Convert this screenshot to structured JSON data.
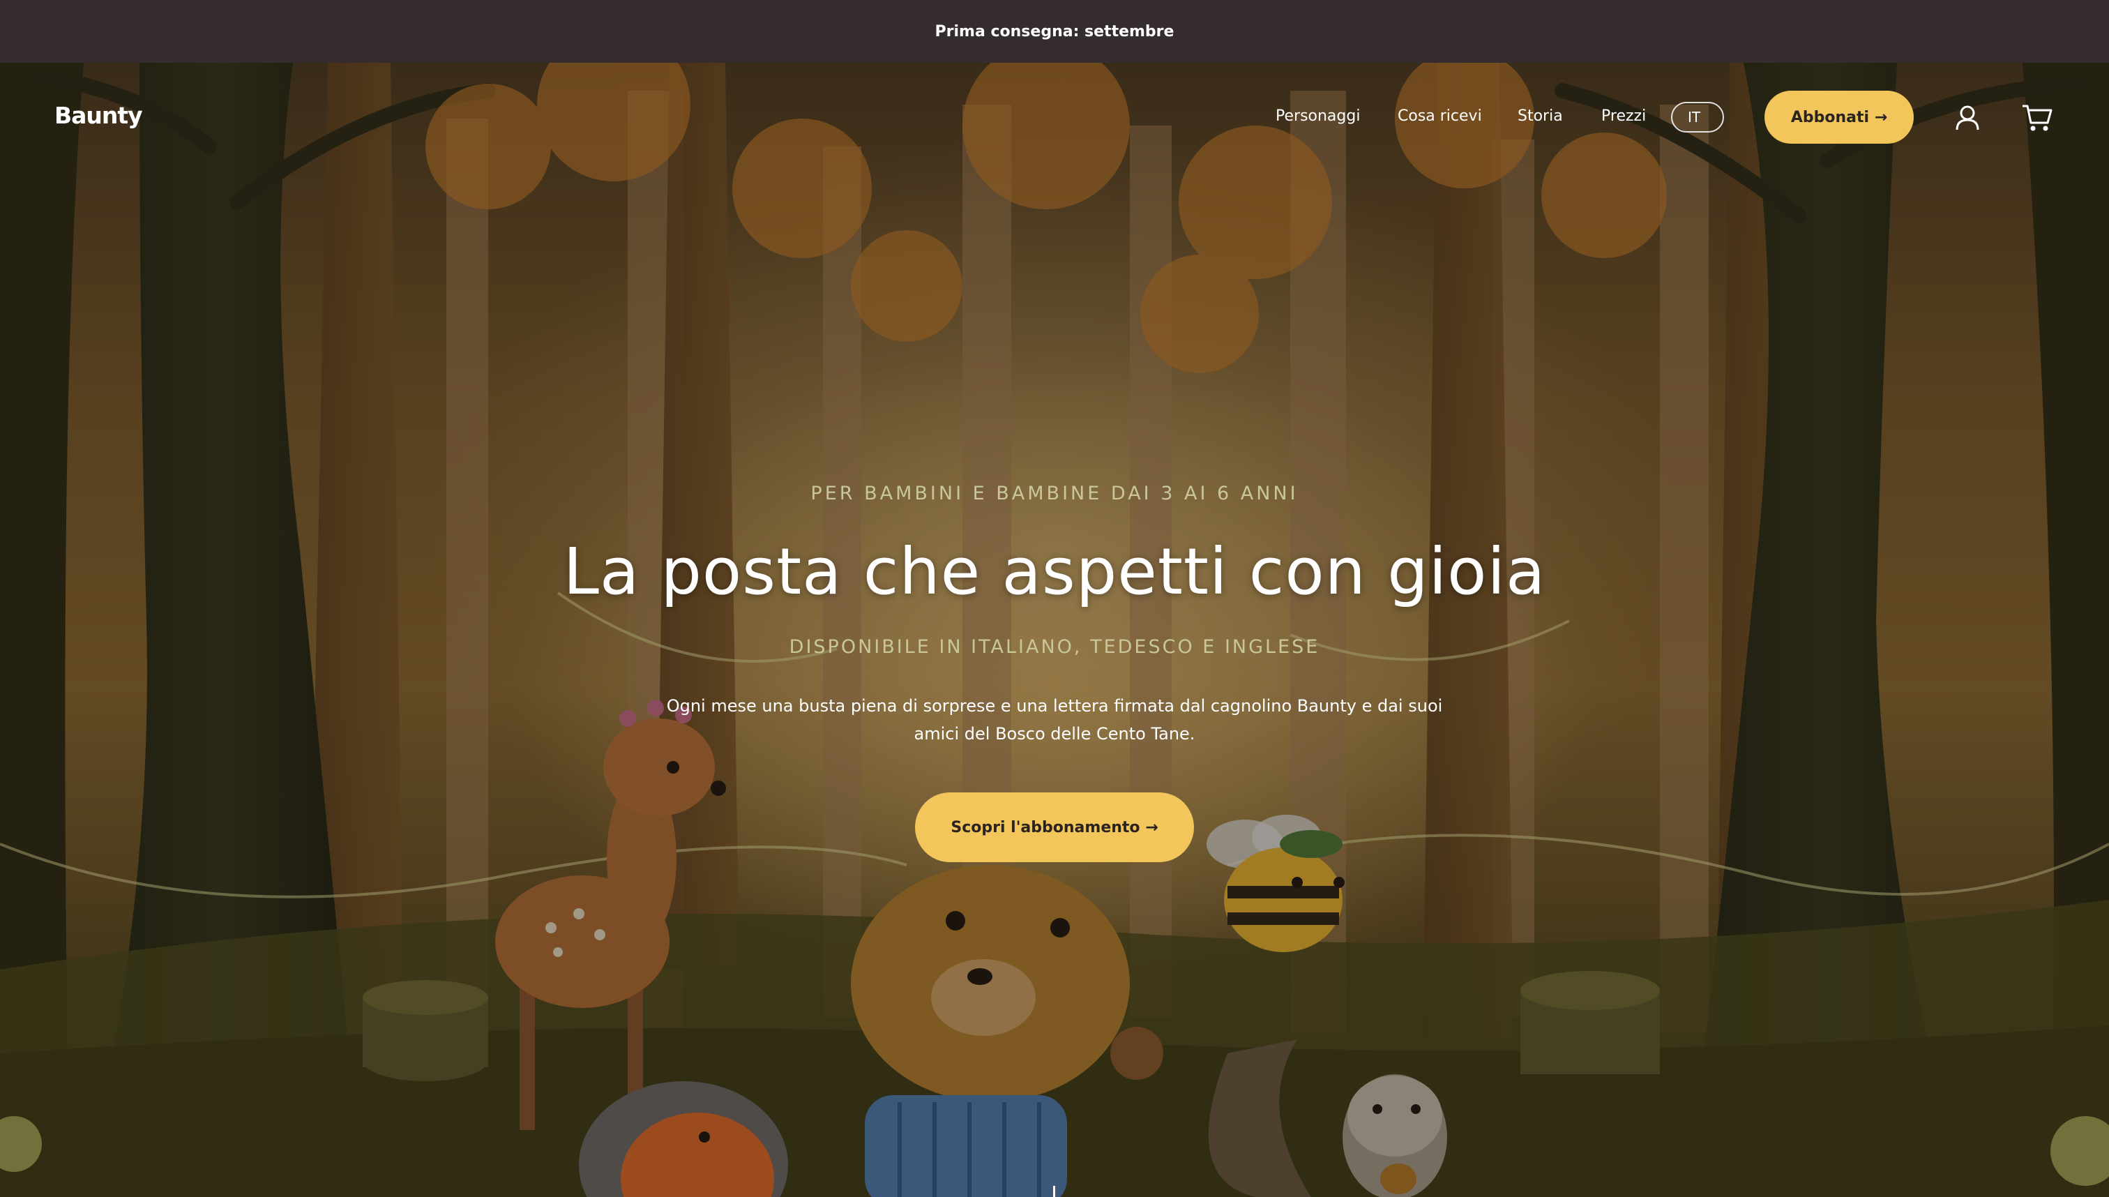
{
  "announcement": {
    "text": "Prima consegna: settembre"
  },
  "header": {
    "logo": "Baunty",
    "nav": {
      "personaggi": "Personaggi",
      "cosa_ricevi": "Cosa ricevi",
      "storia": "Storia",
      "prezzi": "Prezzi"
    },
    "language": "IT",
    "cta_label": "Abbonati →",
    "account_icon": "user-icon",
    "cart_icon": "cart-icon"
  },
  "hero": {
    "eyebrow": "PER BAMBINI E BAMBINE DAI 3 AI 6 ANNI",
    "headline": "La posta che aspetti con gioia",
    "subheadline": "DISPONIBILE IN ITALIANO, TEDESCO E INGLESE",
    "description": "Ogni mese una busta piena di sorprese e una lettera firmata dal cagnolino Baunty e dai suoi amici del Bosco delle Cento Tane.",
    "cta_label": "Scopri l'abbonamento →"
  },
  "colors": {
    "announcement_bg": "#352c2d",
    "accent_yellow": "#f2c65a",
    "eyebrow_text": "#c9c79a"
  }
}
